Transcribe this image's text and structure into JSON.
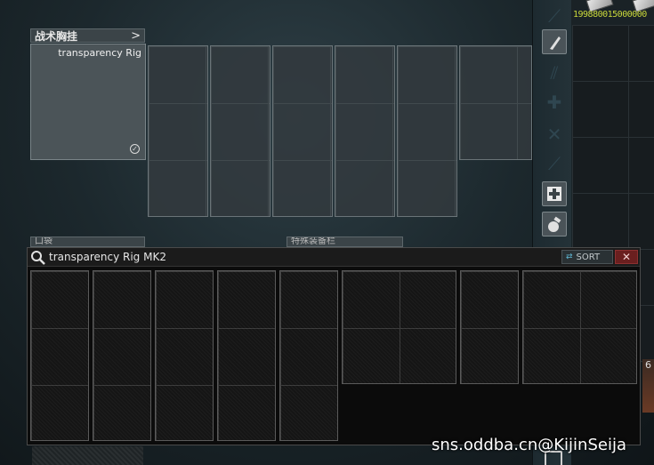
{
  "stash_header": {
    "money_text": "199880015000000"
  },
  "tactical_rig": {
    "title": "战术胸挂",
    "arrow": ">",
    "equipped_item": "transparency Rig",
    "status_icon": "check-circle-icon"
  },
  "behind_labels": {
    "pockets": "口袋",
    "special": "特殊装备栏"
  },
  "sidebar_icons": [
    {
      "name": "rifle-icon",
      "active": false
    },
    {
      "name": "magazine-icon",
      "active": true
    },
    {
      "name": "ammo-icon",
      "active": false
    },
    {
      "name": "medical-cross-icon",
      "active": false
    },
    {
      "name": "tools-icon",
      "active": false
    },
    {
      "name": "knife-icon",
      "active": false
    },
    {
      "name": "medkit-icon",
      "active": true
    },
    {
      "name": "grenade-icon",
      "active": true
    }
  ],
  "overlay": {
    "title": "transparency Rig MK2",
    "sort_label": "SORT",
    "close_label": "✕"
  },
  "edge_badge": "6",
  "watermark": "sns.oddba.cn@KijinSeija",
  "colors": {
    "money": "#c9d83a",
    "close_button": "#6a1f1f",
    "sort_icon": "#5fb6d2"
  }
}
